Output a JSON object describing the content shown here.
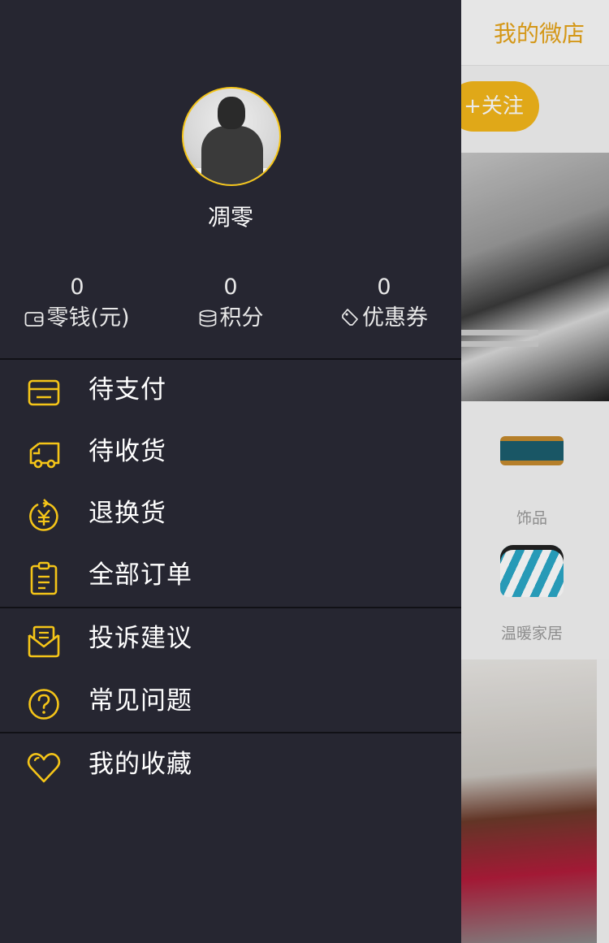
{
  "background": {
    "title": "我的微店",
    "follow_label": "+关注",
    "categories": [
      {
        "label": "饰品",
        "icon": "bracelet-thumbnail"
      },
      {
        "label": "温暖家居",
        "icon": "beanbag-thumbnail"
      }
    ]
  },
  "drawer": {
    "username": "凋零",
    "stats": [
      {
        "value": "0",
        "label": "零钱(元)",
        "icon": "wallet-icon"
      },
      {
        "value": "0",
        "label": "积分",
        "icon": "coins-icon"
      },
      {
        "value": "0",
        "label": "优惠券",
        "icon": "coupon-icon"
      }
    ],
    "menu": [
      {
        "label": "待支付",
        "icon": "card-icon"
      },
      {
        "label": "待收货",
        "icon": "truck-icon"
      },
      {
        "label": "退换货",
        "icon": "refund-icon"
      },
      {
        "label": "全部订单",
        "icon": "clipboard-icon"
      },
      {
        "label": "投诉建议",
        "icon": "feedback-icon"
      },
      {
        "label": "常见问题",
        "icon": "question-icon"
      },
      {
        "label": "我的收藏",
        "icon": "heart-icon"
      }
    ]
  },
  "colors": {
    "drawer_bg": "#262631",
    "accent": "#f5c518",
    "divider": "#111116"
  }
}
